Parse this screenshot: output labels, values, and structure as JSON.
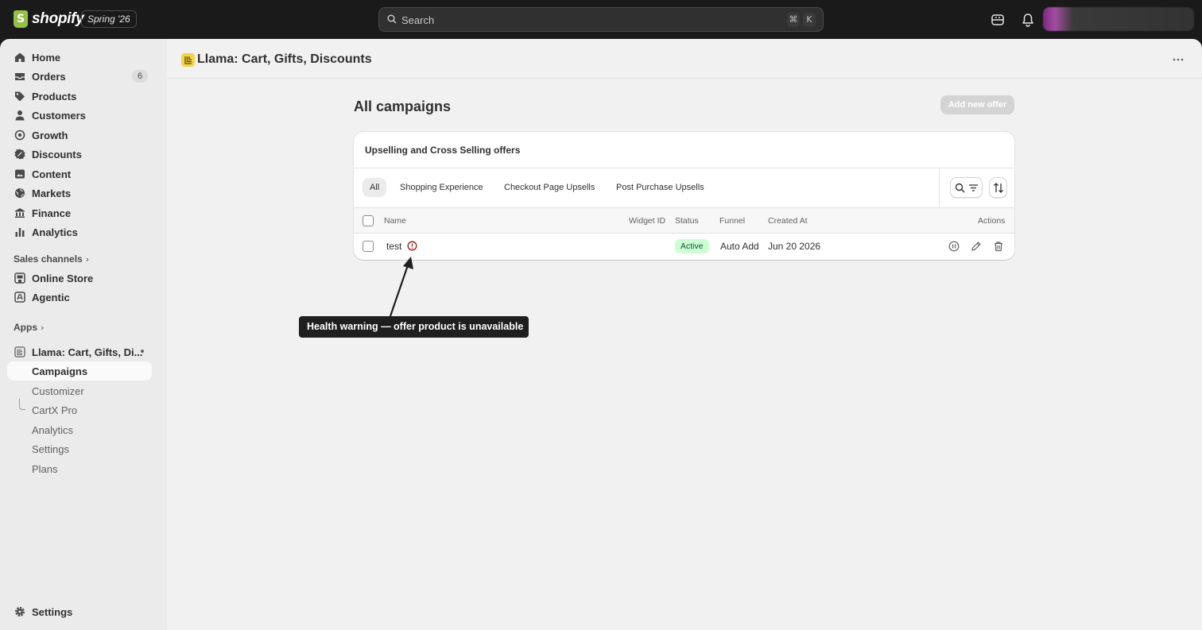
{
  "topbar": {
    "brand": "shopify",
    "edition": "Spring '26",
    "search_placeholder": "Search",
    "shortcut_cmd": "⌘",
    "shortcut_key": "K"
  },
  "sidebar": {
    "items": [
      {
        "label": "Home"
      },
      {
        "label": "Orders",
        "badge": "6"
      },
      {
        "label": "Products"
      },
      {
        "label": "Customers"
      },
      {
        "label": "Growth"
      },
      {
        "label": "Discounts"
      },
      {
        "label": "Content"
      },
      {
        "label": "Markets"
      },
      {
        "label": "Finance"
      },
      {
        "label": "Analytics"
      }
    ],
    "sales_channels_header": "Sales channels",
    "sales_channels": [
      {
        "label": "Online Store"
      },
      {
        "label": "Agentic"
      }
    ],
    "apps_header": "Apps",
    "app_name": "Llama: Cart, Gifts, Di...",
    "app_subitems": [
      {
        "label": "Campaigns"
      },
      {
        "label": "Customizer"
      },
      {
        "label": "CartX Pro"
      },
      {
        "label": "Analytics"
      },
      {
        "label": "Settings"
      },
      {
        "label": "Plans"
      }
    ],
    "settings_label": "Settings"
  },
  "app_header": {
    "title": "Llama: Cart, Gifts, Discounts"
  },
  "page": {
    "title": "All campaigns",
    "add_button": "Add new offer"
  },
  "card": {
    "title": "Upselling and Cross Selling offers",
    "tabs": [
      {
        "label": "All"
      },
      {
        "label": "Shopping Experience"
      },
      {
        "label": "Checkout Page Upsells"
      },
      {
        "label": "Post Purchase Upsells"
      }
    ],
    "columns": {
      "name": "Name",
      "widget_id": "Widget ID",
      "status": "Status",
      "funnel": "Funnel",
      "created_at": "Created At",
      "actions": "Actions"
    },
    "rows": [
      {
        "name": "test",
        "widget_id": "",
        "status": "Active",
        "funnel": "Auto Add",
        "created_at": "Jun 20 2026"
      }
    ]
  },
  "callout": {
    "text": "Health warning — offer product is unavailable"
  },
  "colors": {
    "topbar": "#1a1a1a",
    "sidebar": "#ebebeb",
    "main": "#f1f1f1",
    "active_badge_bg": "#cdfed4",
    "active_badge_text": "#0c5132",
    "warning_icon": "#8e1f0b",
    "app_icon": "#f3d34a"
  }
}
